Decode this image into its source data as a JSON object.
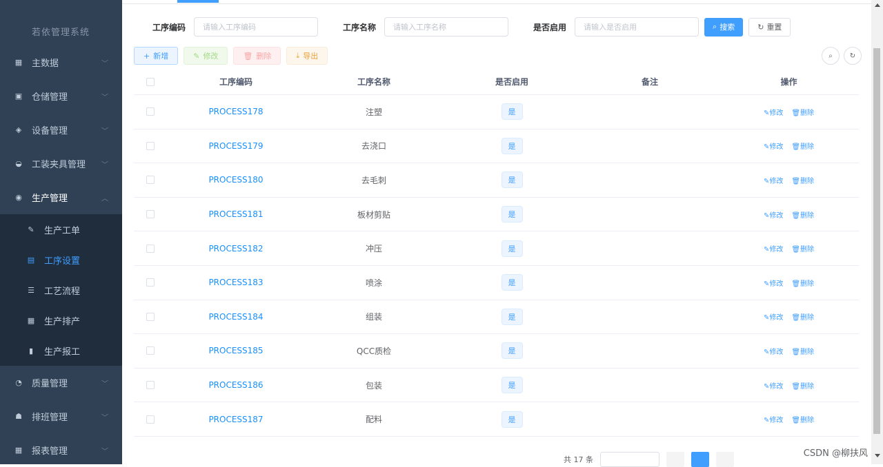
{
  "sidebar": {
    "top_faded_text": "若依管理系统",
    "menus": [
      {
        "label": "主数据",
        "icon": "grid-icon"
      },
      {
        "label": "仓储管理",
        "icon": "warehouse-icon"
      },
      {
        "label": "设备管理",
        "icon": "layers-icon"
      },
      {
        "label": "工装夹具管理",
        "icon": "lock-icon"
      },
      {
        "label": "生产管理",
        "icon": "eye-icon"
      }
    ],
    "sub_items": [
      {
        "label": "生产工单",
        "icon": "edit-icon"
      },
      {
        "label": "工序设置",
        "icon": "form-icon"
      },
      {
        "label": "工艺流程",
        "icon": "list-icon"
      },
      {
        "label": "生产排产",
        "icon": "table-icon"
      },
      {
        "label": "生产报工",
        "icon": "bar-chart-icon"
      }
    ],
    "menus_after": [
      {
        "label": "质量管理",
        "icon": "quality-icon"
      },
      {
        "label": "排班管理",
        "icon": "people-icon"
      },
      {
        "label": "报表管理",
        "icon": "report-icon"
      }
    ]
  },
  "search": {
    "code_label": "工序编码",
    "code_placeholder": "请输入工序编码",
    "name_label": "工序名称",
    "name_placeholder": "请输入工序名称",
    "enable_label": "是否启用",
    "enable_placeholder": "请输入是否启用",
    "search_btn": "搜索",
    "reset_btn": "重置"
  },
  "toolbar": {
    "add": "新增",
    "edit": "修改",
    "delete": "删除",
    "export": "导出"
  },
  "table": {
    "headers": [
      "工序编码",
      "工序名称",
      "是否启用",
      "备注",
      "操作"
    ],
    "rows": [
      {
        "code": "PROCESS178",
        "name": "注塑",
        "enabled": "是",
        "remark": ""
      },
      {
        "code": "PROCESS179",
        "name": "去浇口",
        "enabled": "是",
        "remark": ""
      },
      {
        "code": "PROCESS180",
        "name": "去毛刺",
        "enabled": "是",
        "remark": ""
      },
      {
        "code": "PROCESS181",
        "name": "板材剪贴",
        "enabled": "是",
        "remark": ""
      },
      {
        "code": "PROCESS182",
        "name": "冲压",
        "enabled": "是",
        "remark": ""
      },
      {
        "code": "PROCESS183",
        "name": "喷涂",
        "enabled": "是",
        "remark": ""
      },
      {
        "code": "PROCESS184",
        "name": "组装",
        "enabled": "是",
        "remark": ""
      },
      {
        "code": "PROCESS185",
        "name": "QCC质检",
        "enabled": "是",
        "remark": ""
      },
      {
        "code": "PROCESS186",
        "name": "包装",
        "enabled": "是",
        "remark": ""
      },
      {
        "code": "PROCESS187",
        "name": "配料",
        "enabled": "是",
        "remark": ""
      }
    ],
    "op_edit": "修改",
    "op_delete": "删除"
  },
  "pagination": {
    "total_text": "共 17 条"
  },
  "watermark": "CSDN @柳扶风"
}
